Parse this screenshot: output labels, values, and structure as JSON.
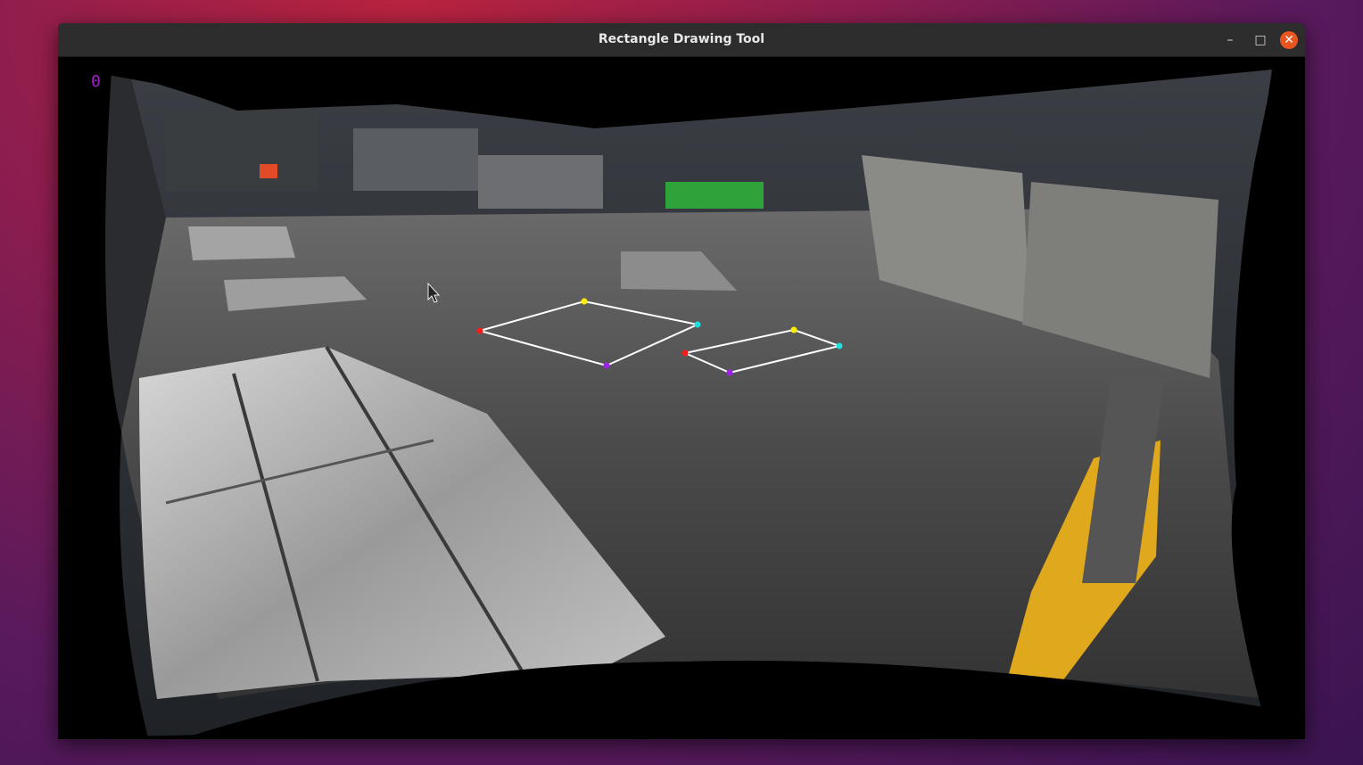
{
  "window": {
    "title": "Rectangle Drawing Tool",
    "controls": {
      "minimize": "–",
      "maximize": "□",
      "close": "✕"
    }
  },
  "canvas": {
    "overlay_counter": "0",
    "point_colors": {
      "p1": "#ff1a1a",
      "p2": "#ffee00",
      "p3": "#1ee0e0",
      "p4": "#a020f0"
    },
    "line_color": "#ffffff"
  },
  "icons": [
    "minimize-icon",
    "maximize-icon",
    "close-icon",
    "cursor-icon"
  ]
}
